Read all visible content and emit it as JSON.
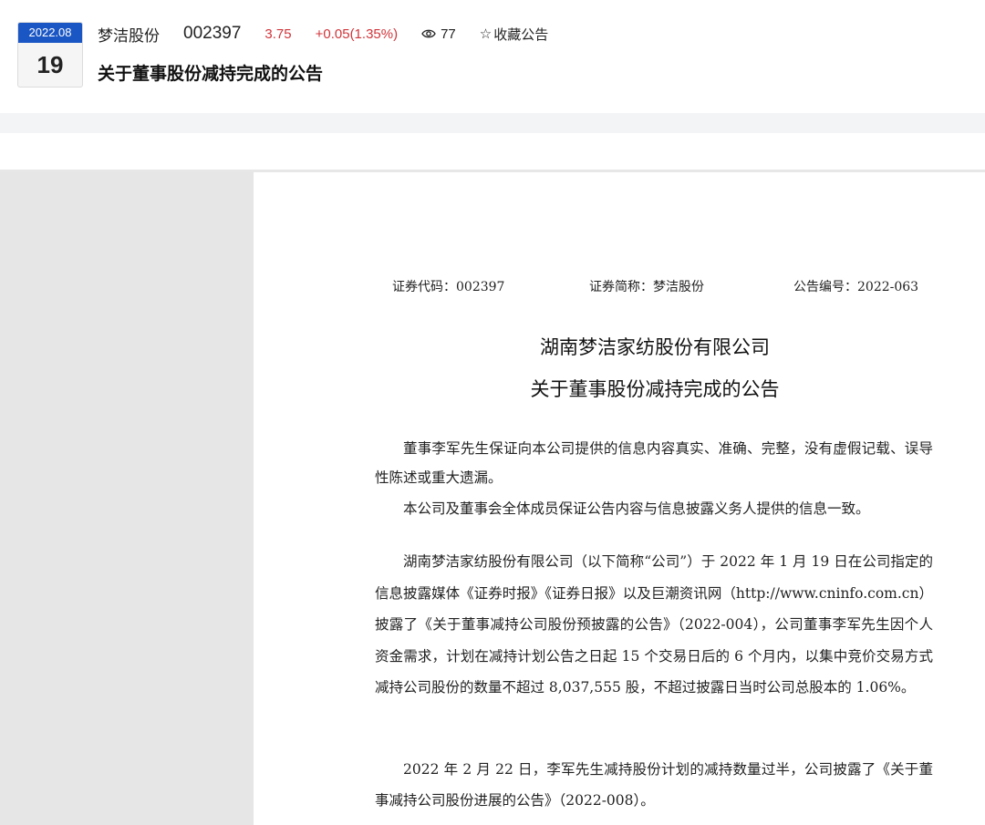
{
  "header": {
    "date_year_month": "2022.08",
    "date_day": "19",
    "stock_name": "梦洁股份",
    "stock_code": "002397",
    "price": "3.75",
    "change": "+0.05(1.35%)",
    "views": "77",
    "favorite_label": "收藏公告",
    "title": "关于董事股份减持完成的公告"
  },
  "colors": {
    "accent_blue": "#1a56c4",
    "price_red": "#d0353a"
  },
  "icons": {
    "views": "eye-icon",
    "favorite": "star-outline-icon"
  },
  "document": {
    "securities_code": "证券代码：002397",
    "securities_short_name": "证券简称：梦洁股份",
    "announcement_number": "公告编号：2022-063",
    "company_name": "湖南梦洁家纺股份有限公司",
    "announcement_title": "关于董事股份减持完成的公告",
    "notice_1": "董事李军先生保证向本公司提供的信息内容真实、准确、完整，没有虚假记载、误导性陈述或重大遗漏。",
    "notice_2": "本公司及董事会全体成员保证公告内容与信息披露义务人提供的信息一致。",
    "body_1": "湖南梦洁家纺股份有限公司（以下简称“公司”）于 2022 年 1 月 19 日在公司指定的信息披露媒体《证券时报》《证券日报》以及巨潮资讯网（http://www.cninfo.com.cn）披露了《关于董事减持公司股份预披露的公告》（2022-004），公司董事李军先生因个人资金需求，计划在减持计划公告之日起 15 个交易日后的 6 个月内，以集中竞价交易方式减持公司股份的数量不超过 8,037,555 股，不超过披露日当时公司总股本的 1.06%。",
    "body_2": "2022 年 2 月 22 日，李军先生减持股份计划的减持数量过半，公司披露了《关于董事减持公司股份进展的公告》（2022-008）。"
  }
}
